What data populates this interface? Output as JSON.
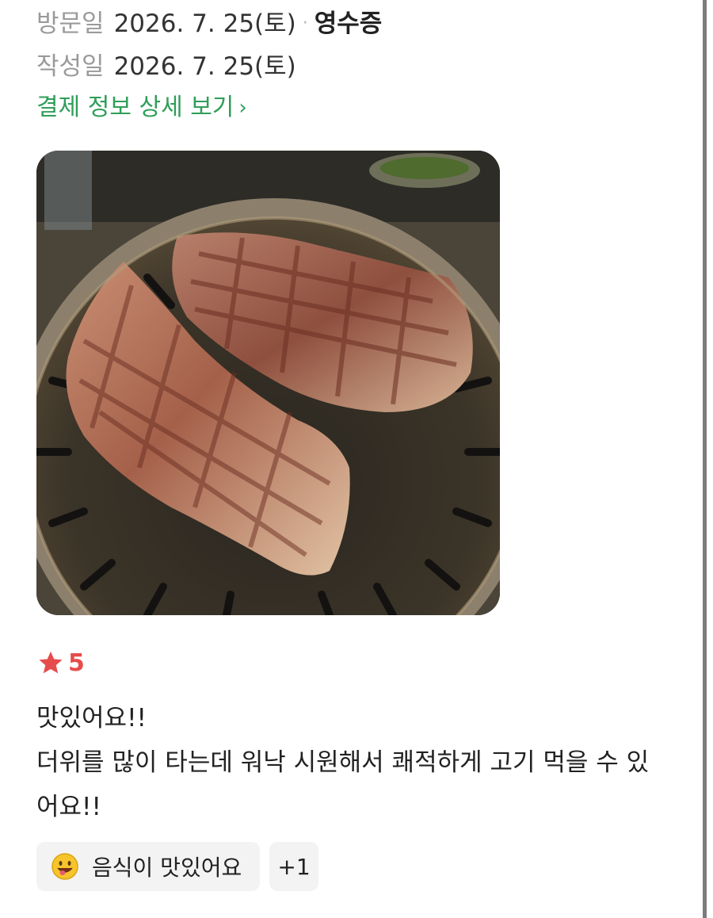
{
  "visit": {
    "label": "방문일",
    "date": "2026. 7. 25(토)",
    "separator": "·",
    "receipt": "영수증"
  },
  "written": {
    "label": "작성일",
    "date": "2026. 7. 25(토)"
  },
  "payment_link": {
    "label": "결제 정보 상세 보기",
    "chevron": "›"
  },
  "photo": {
    "subject": "grilled pork belly on grill",
    "icon": "photo"
  },
  "rating": {
    "icon": "star-icon",
    "score": "5",
    "color": "#e74c4c"
  },
  "review": {
    "lines": [
      "맛있어요!!",
      "더위를 많이 타는데 워낙 시원해서 쾌적하게 고기 먹을 수 있",
      "어요!!"
    ]
  },
  "keywords": {
    "chip_label": "음식이 맛있어요",
    "chip_icon": "smiley-icon",
    "more_label": "+1"
  },
  "colors": {
    "link": "#2f9e58",
    "star": "#e74c4c",
    "chip_bg": "#f3f3f3"
  }
}
